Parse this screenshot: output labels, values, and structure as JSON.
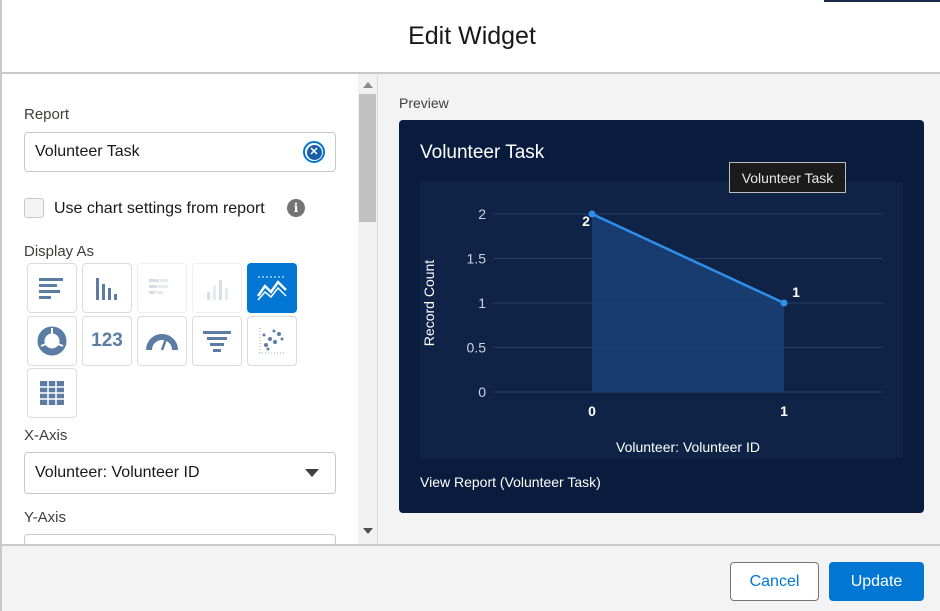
{
  "dialog": {
    "title": "Edit Widget"
  },
  "form": {
    "report_label": "Report",
    "report_value": "Volunteer Task",
    "use_chart_settings_label": "Use chart settings from report",
    "display_as_label": "Display As",
    "chart_types": [
      {
        "name": "horizontal-bar",
        "state": "enabled"
      },
      {
        "name": "vertical-bar",
        "state": "enabled"
      },
      {
        "name": "stacked-horizontal-bar",
        "state": "disabled"
      },
      {
        "name": "stacked-vertical-bar",
        "state": "disabled"
      },
      {
        "name": "line",
        "state": "selected"
      },
      {
        "name": "donut",
        "state": "enabled"
      },
      {
        "name": "metric",
        "state": "enabled",
        "text": "123"
      },
      {
        "name": "gauge",
        "state": "enabled"
      },
      {
        "name": "funnel",
        "state": "enabled"
      },
      {
        "name": "scatter",
        "state": "enabled"
      },
      {
        "name": "table",
        "state": "enabled"
      }
    ],
    "x_axis_label": "X-Axis",
    "x_axis_value": "Volunteer: Volunteer ID",
    "y_axis_label": "Y-Axis"
  },
  "preview": {
    "label": "Preview",
    "card_title": "Volunteer Task",
    "tooltip": "Volunteer Task",
    "view_report_link": "View Report (Volunteer Task)"
  },
  "chart_data": {
    "type": "line",
    "title": "Volunteer Task",
    "xlabel": "Volunteer: Volunteer ID",
    "ylabel": "Record Count",
    "x": [
      "0",
      "1"
    ],
    "series": [
      {
        "values": [
          2,
          1
        ]
      }
    ],
    "data_labels": [
      "2",
      "1"
    ],
    "y_ticks": [
      "0",
      "0.5",
      "1",
      "1.5",
      "2"
    ],
    "ylim": [
      0,
      2
    ],
    "grid": true,
    "colors": {
      "line": "#2e8fe8",
      "area": "#1b3f74",
      "background": "#0a1c3d",
      "plot": "#0f2347"
    }
  },
  "footer": {
    "cancel_label": "Cancel",
    "update_label": "Update"
  },
  "colors": {
    "accent": "#0176d3",
    "selected_chart": "#0176d3"
  }
}
